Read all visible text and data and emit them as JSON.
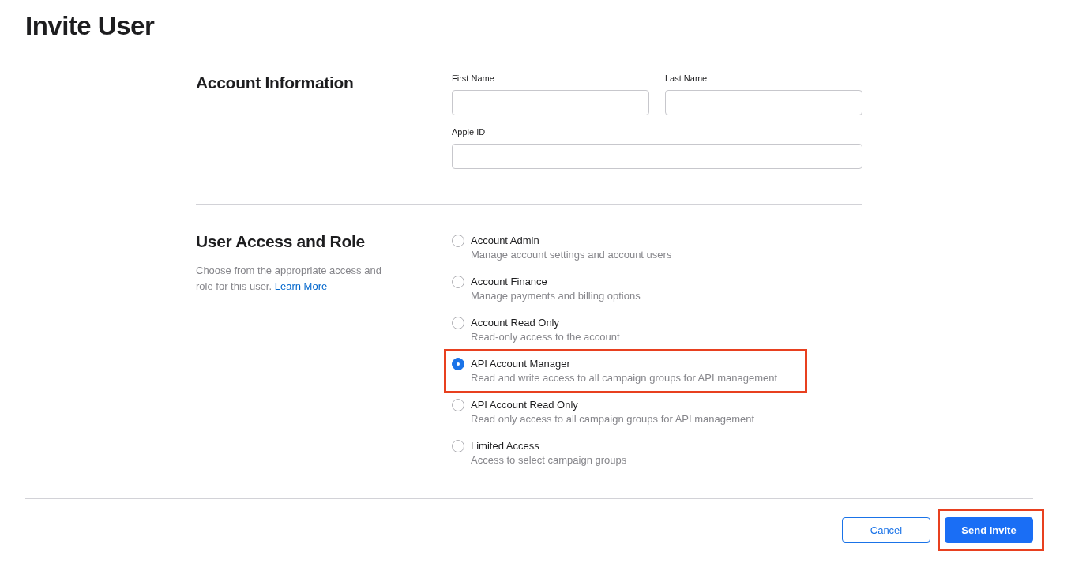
{
  "title": "Invite User",
  "account_information": {
    "heading": "Account Information",
    "fields": [
      {
        "label": "First Name",
        "kind": "half"
      },
      {
        "label": "Last Name",
        "kind": "half"
      },
      {
        "label": "Apple ID",
        "kind": "full"
      }
    ]
  },
  "user_access": {
    "heading": "User Access and Role",
    "description": "Choose from the appropriate access and role for this user.",
    "link": "Learn More",
    "roles": [
      {
        "label": "Account Admin",
        "description": "Manage account settings and account users",
        "selected": false,
        "highlighted": false
      },
      {
        "label": "Account Finance",
        "description": "Manage payments and billing options",
        "selected": false,
        "highlighted": false
      },
      {
        "label": "Account Read Only",
        "description": "Read-only access to the account",
        "selected": false,
        "highlighted": false
      },
      {
        "label": "API Account Manager",
        "description": "Read and write access to all campaign groups for API management",
        "selected": true,
        "highlighted": true
      },
      {
        "label": "API Account Read Only",
        "description": "Read only access to all campaign groups for API management",
        "selected": false,
        "highlighted": false
      },
      {
        "label": "Limited Access",
        "description": "Access to select campaign groups",
        "selected": false,
        "highlighted": false
      }
    ]
  },
  "buttons": [
    {
      "label": "Cancel",
      "kind": "secondary",
      "highlighted": false
    },
    {
      "label": "Send Invite",
      "kind": "primary",
      "highlighted": true
    }
  ]
}
